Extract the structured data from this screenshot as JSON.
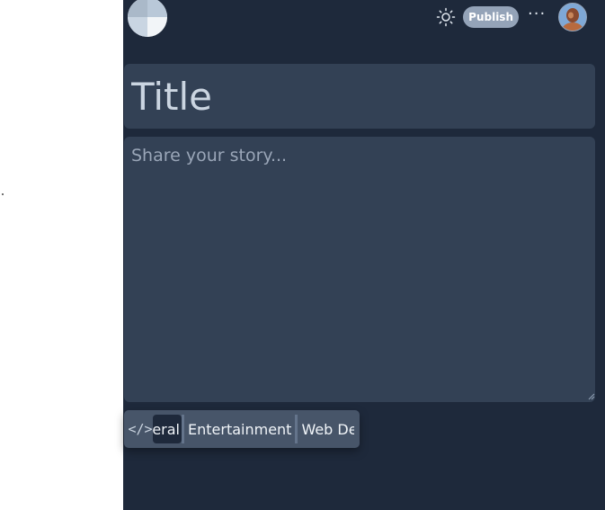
{
  "topbar": {
    "publish_label": "Publish",
    "more_label": "···",
    "icons": {
      "theme": "sun-icon",
      "more": "ellipsis-icon",
      "logo": "pie-logo-icon",
      "avatar": "user-avatar"
    }
  },
  "editor": {
    "title_placeholder": "Title",
    "story_placeholder": "Share your story..."
  },
  "categories": {
    "code_icon_label": "</>",
    "items": [
      {
        "label": "eral",
        "selected": true
      },
      {
        "label": "Entertainment",
        "selected": false
      },
      {
        "label": "Web De",
        "selected": false
      }
    ]
  },
  "colors": {
    "background": "#1e293b",
    "panel": "#334155",
    "chip_bar": "#475569",
    "publish_button": "#94a3b8"
  }
}
